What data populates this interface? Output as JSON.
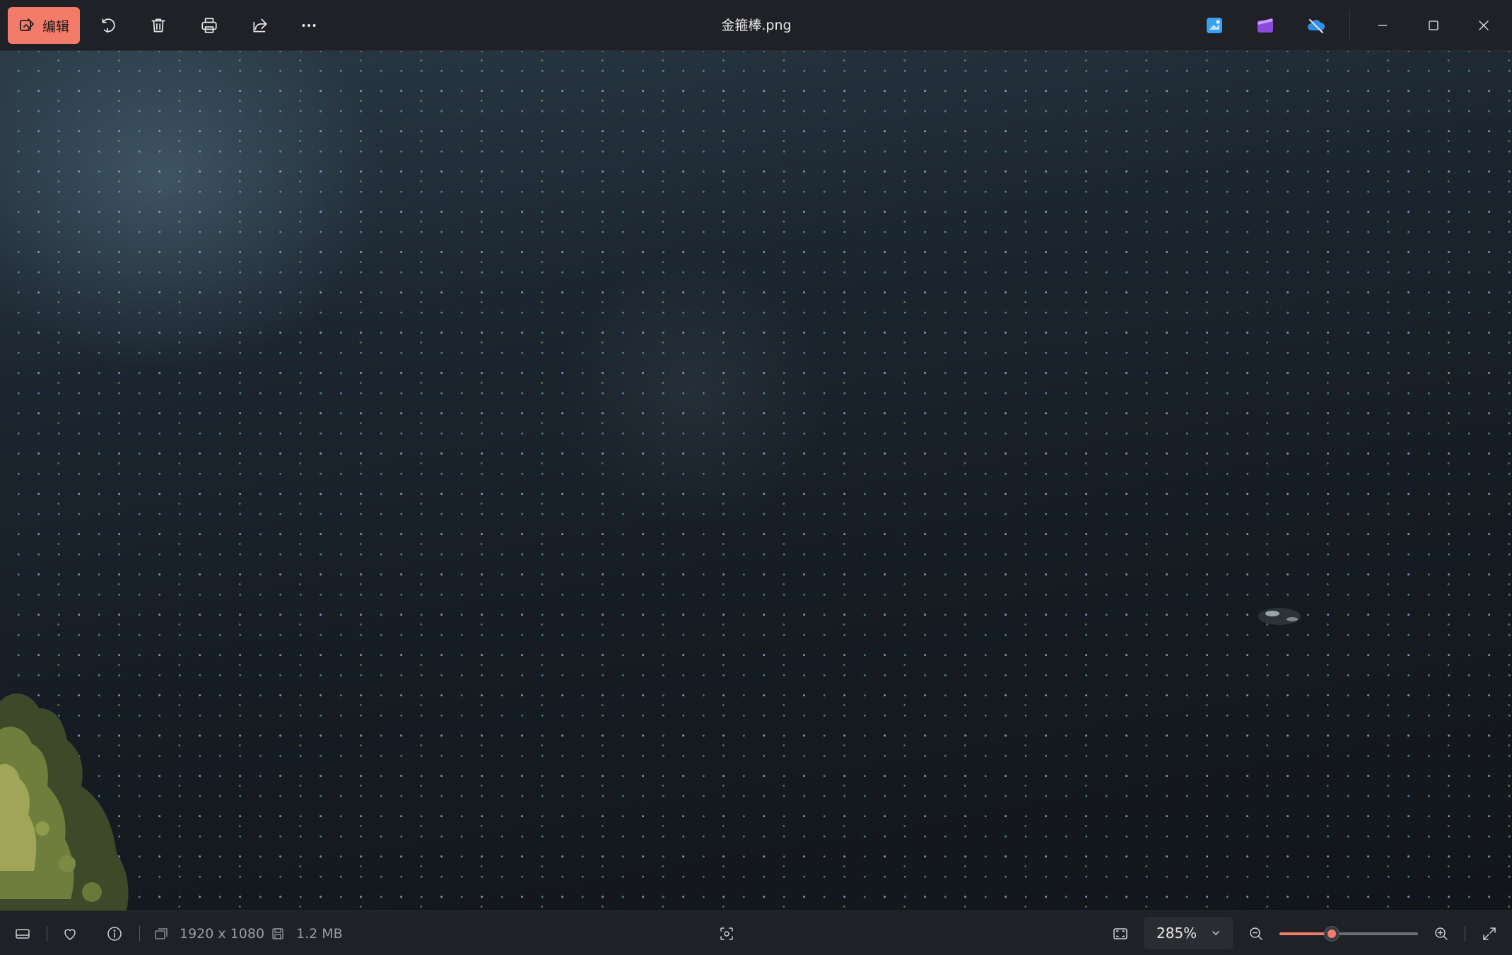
{
  "toolbar": {
    "edit_label": "编辑",
    "icons": [
      "rotate-icon",
      "delete-icon",
      "print-icon",
      "share-icon",
      "more-icon"
    ]
  },
  "window": {
    "title": "金箍棒.png",
    "app_icons": [
      "photos-editor-icon",
      "clipchamp-icon",
      "onedrive-icon"
    ]
  },
  "statusbar": {
    "dimensions": "1920 x 1080",
    "file_size": "1.2 MB",
    "zoom_label": "285%",
    "zoom_fraction": 0.38
  },
  "colors": {
    "accent": "#f47b6a",
    "titlebar_bg": "#1f2126",
    "text_primary": "#e8e8e8",
    "text_secondary": "#9a9ca2"
  }
}
